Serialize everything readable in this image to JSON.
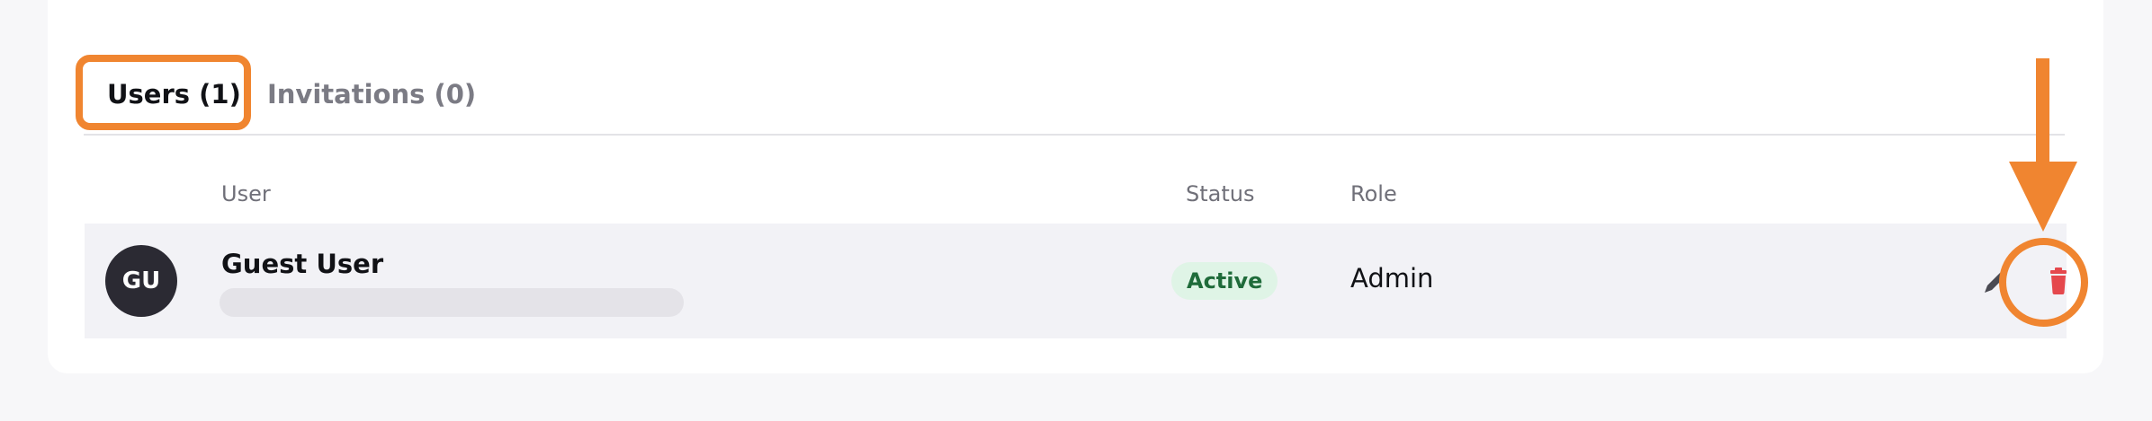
{
  "tabs": [
    {
      "label": "Users (1)",
      "active": true
    },
    {
      "label": "Invitations (0)",
      "active": false
    }
  ],
  "table": {
    "headers": {
      "user": "User",
      "status": "Status",
      "role": "Role"
    },
    "rows": [
      {
        "avatar_initials": "GU",
        "name": "Guest User",
        "status": "Active",
        "role": "Admin",
        "actions": [
          "edit-icon",
          "delete-icon"
        ]
      }
    ]
  },
  "colors": {
    "highlight": "#f08530",
    "status_active_bg": "#dff4e6",
    "status_active_text": "#1f6b3a",
    "delete": "#e5484d",
    "avatar_bg": "#2b2a33"
  }
}
